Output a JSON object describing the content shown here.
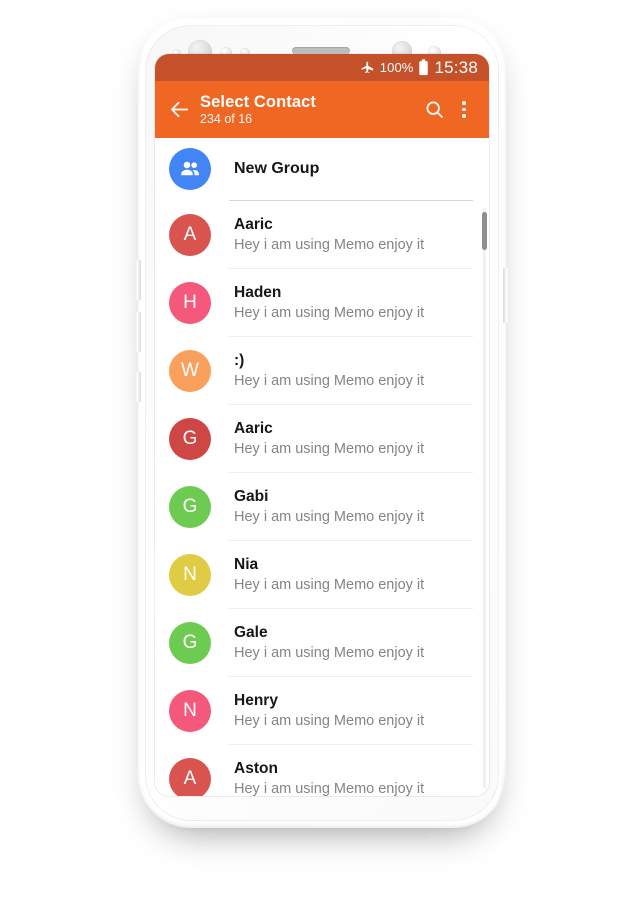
{
  "status_bar": {
    "airplane_icon": "airplane-mode-icon",
    "battery_percent": "100%",
    "battery_icon": "battery-full-icon",
    "clock": "15:38"
  },
  "app_bar": {
    "back_icon": "back-arrow-icon",
    "title": "Select Contact",
    "subtitle": "234 of 16",
    "search_icon": "search-icon",
    "overflow_icon": "overflow-menu-icon",
    "background": "#ef6723"
  },
  "new_group": {
    "label": "New Group",
    "icon": "group-people-icon",
    "avatar_color": "#4285f4"
  },
  "contacts": [
    {
      "name": "Aaric",
      "status": "Hey i am using Memo enjoy it",
      "initial": "A",
      "color": "#d9534f"
    },
    {
      "name": "Haden",
      "status": "Hey i am using Memo enjoy it",
      "initial": "H",
      "color": "#f4587a"
    },
    {
      "name": ":)",
      "status": "Hey i am using Memo enjoy it",
      "initial": "W",
      "color": "#f9a05c"
    },
    {
      "name": "Aaric",
      "status": "Hey i am using Memo enjoy it",
      "initial": "G",
      "color": "#cf4745"
    },
    {
      "name": "Gabi",
      "status": "Hey i am using Memo enjoy it",
      "initial": "G",
      "color": "#6ecb52"
    },
    {
      "name": "Nia",
      "status": "Hey i am using Memo enjoy it",
      "initial": "N",
      "color": "#e0cb44"
    },
    {
      "name": "Gale",
      "status": "Hey i am using Memo enjoy it",
      "initial": "G",
      "color": "#6ecb52"
    },
    {
      "name": "Henry",
      "status": "Hey i am using Memo enjoy it",
      "initial": "N",
      "color": "#f4587a"
    },
    {
      "name": "Aston",
      "status": "Hey i am using Memo enjoy it",
      "initial": "A",
      "color": "#d9534f"
    }
  ],
  "device": {
    "frame_color": "#ffffff",
    "earpiece": "earpiece-speaker",
    "front_camera": "front-camera-icon"
  }
}
